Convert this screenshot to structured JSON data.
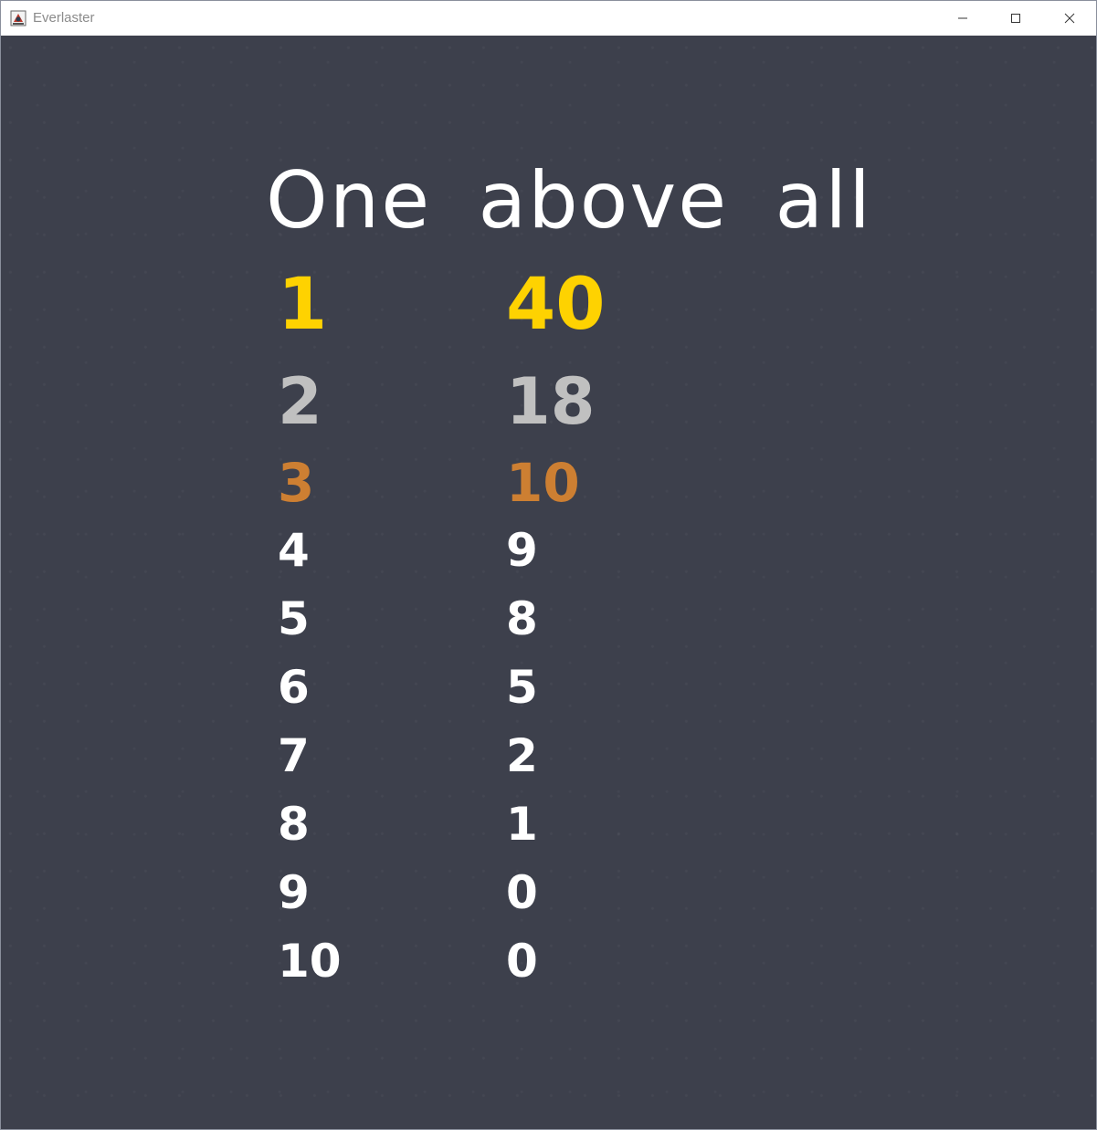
{
  "window": {
    "title": "Everlaster"
  },
  "leaderboard": {
    "heading": "One above all",
    "colors": {
      "gold": "#fed201",
      "silver": "#c0c0c0",
      "bronze": "#cd7f32",
      "normal": "#ffffff",
      "background": "#3d404c"
    },
    "rows": [
      {
        "rank": "1",
        "score": "40"
      },
      {
        "rank": "2",
        "score": "18"
      },
      {
        "rank": "3",
        "score": "10"
      },
      {
        "rank": "4",
        "score": "9"
      },
      {
        "rank": "5",
        "score": "8"
      },
      {
        "rank": "6",
        "score": "5"
      },
      {
        "rank": "7",
        "score": "2"
      },
      {
        "rank": "8",
        "score": "1"
      },
      {
        "rank": "9",
        "score": "0"
      },
      {
        "rank": "10",
        "score": "0"
      }
    ]
  }
}
